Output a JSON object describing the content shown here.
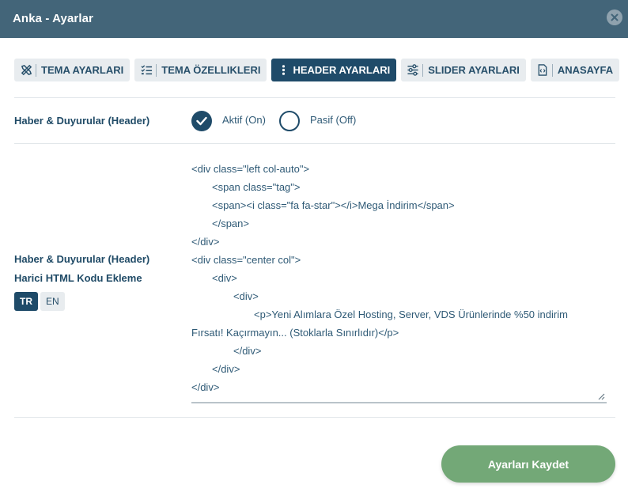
{
  "window": {
    "title": "Anka - Ayarlar"
  },
  "tabs": [
    {
      "label": "TEMA AYARLARI",
      "icon": "tools-icon",
      "active": false
    },
    {
      "label": "TEMA ÖZELLIKLERI",
      "icon": "checklist-icon",
      "active": false
    },
    {
      "label": "HEADER AYARLARI",
      "icon": "vertical-dots-icon",
      "active": true
    },
    {
      "label": "SLIDER AYARLARI",
      "icon": "sliders-icon",
      "active": false
    },
    {
      "label": "ANASAYFA",
      "icon": "code-file-icon",
      "active": false
    }
  ],
  "header_news": {
    "label": "Haber & Duyurular (Header)",
    "options": [
      {
        "label": "Aktif (On)",
        "selected": true
      },
      {
        "label": "Pasif (Off)",
        "selected": false
      }
    ]
  },
  "html_code": {
    "label_line1": "Haber & Duyurular (Header)",
    "label_line2": "Harici HTML Kodu Ekleme",
    "languages": [
      "TR",
      "EN"
    ],
    "active_language": "TR",
    "lines": [
      "<div class=\"left col-auto\">",
      "<span class=\"tag\">",
      "<span><i class=\"fa fa-star\"></i>Mega İndirim</span>",
      "</span>",
      "</div>",
      "<div class=\"center col\">",
      "<div>",
      "<div>",
      "<p>Yeni Alımlara Özel Hosting, Server, VDS Ürünlerinde %50 indirim",
      "Fırsatı! Kaçırmayın... (Stoklarla Sınırlıdır)</p>",
      "</div>",
      "</div>",
      "</div>"
    ]
  },
  "save_button": {
    "label": "Ayarları Kaydet"
  },
  "colors": {
    "titlebar": "#436579",
    "primary": "#1f4b69",
    "save": "#73a877",
    "tab_bg": "#e8ecef"
  }
}
